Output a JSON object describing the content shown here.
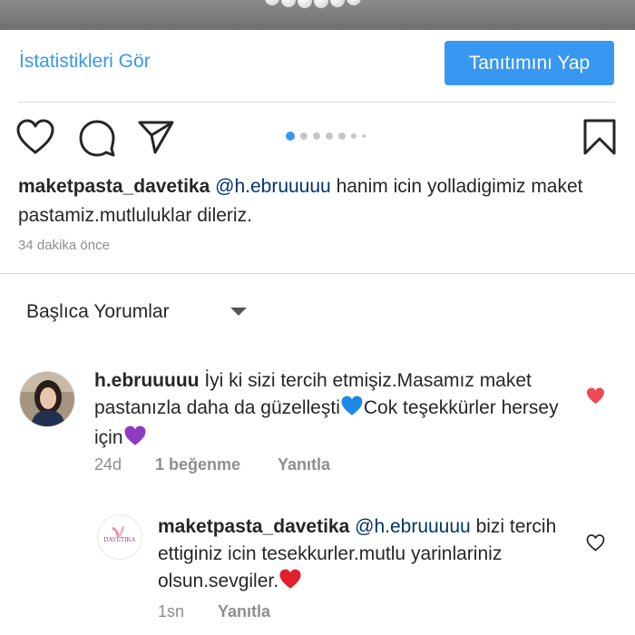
{
  "post": {
    "stats_link": "İstatistikleri Gör",
    "promote_button": "Tanıtımını Yap",
    "carousel": {
      "count": 7,
      "active_index": 0
    },
    "caption": {
      "username": "maketpasta_davetika",
      "mention": "@h.ebruuuuu",
      "text": " hanim icin yolladigimiz maket pastamiz.mutluluklar dileriz."
    },
    "timestamp": "34 dakika önce"
  },
  "comments_section": {
    "sort_label": "Başlıca Yorumlar"
  },
  "comment1": {
    "username": "h.ebruuuuu",
    "text_part1": " İyi ki sizi tercih etmişiz.Masamız maket pastanızla daha da güzelleşti",
    "text_part2": "Cok teşekkürler hersey için",
    "time": "24d",
    "likes": "1 beğenme",
    "reply": "Yanıtla",
    "liked": true
  },
  "reply1": {
    "username": "maketpasta_davetika",
    "mention": "@h.ebruuuuu",
    "text": " bizi tercih ettiginiz icin tesekkurler.mutlu yarinlariniz olsun.sevgiler.",
    "avatar_brand": "DAVETIKA",
    "time": "1sn",
    "reply": "Yanıtla",
    "liked": false
  },
  "colors": {
    "link_blue": "#3897f0",
    "mention_blue": "#003569",
    "like_red": "#ed4956",
    "meta_gray": "#8e8e8e"
  }
}
